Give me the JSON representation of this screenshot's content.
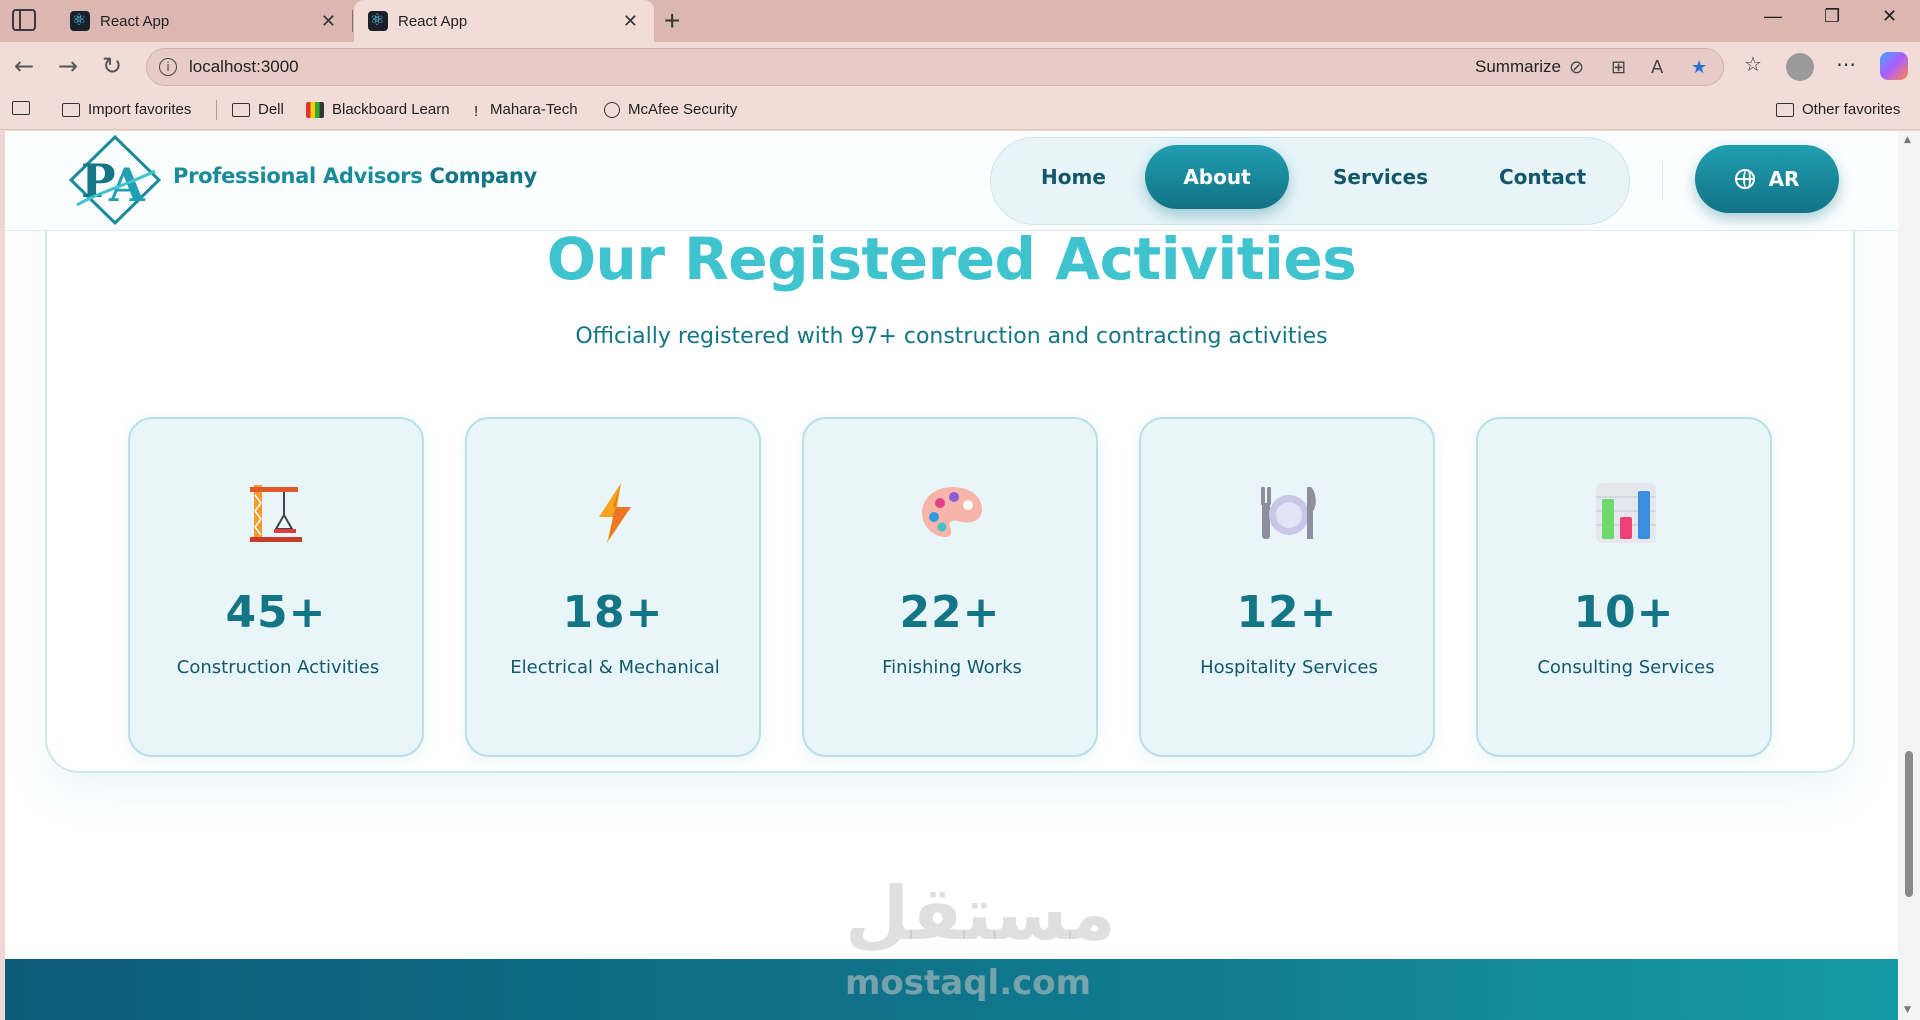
{
  "browser": {
    "tabs": [
      {
        "title": "React App",
        "active": false
      },
      {
        "title": "React App",
        "active": true
      }
    ],
    "url": "localhost:3000",
    "summarize_label": "Summarize",
    "bookmarks": [
      "Import favorites",
      "Dell",
      "Blackboard Learn",
      "Mahara-Tech",
      "McAfee Security"
    ],
    "other_favorites": "Other favorites"
  },
  "header": {
    "logo_text": "Professional Advisors",
    "logo_text_company": "Company",
    "nav": [
      {
        "label": "Home",
        "active": false
      },
      {
        "label": "About",
        "active": true
      },
      {
        "label": "Services",
        "active": false
      },
      {
        "label": "Contact",
        "active": false
      }
    ],
    "lang_label": "AR"
  },
  "section": {
    "title": "Our Registered Activities",
    "subtitle": "Officially registered with 97+ construction and contracting activities",
    "stats": [
      {
        "icon": "crane-icon",
        "value": "45+",
        "label": "Construction Activities"
      },
      {
        "icon": "lightning-icon",
        "value": "18+",
        "label": "Electrical & Mechanical"
      },
      {
        "icon": "palette-icon",
        "value": "22+",
        "label": "Finishing Works"
      },
      {
        "icon": "fork-knife-plate-icon",
        "value": "12+",
        "label": "Hospitality Services"
      },
      {
        "icon": "bar-chart-icon",
        "value": "10+",
        "label": "Consulting Services"
      }
    ]
  },
  "watermark": {
    "arabic": "مستقل",
    "latin": "mostaql.com"
  },
  "colors": {
    "accent": "#1f9fb0",
    "accent_dark": "#137585",
    "title_cyan": "#3fc3cf",
    "card_bg": "#e8f6fa"
  }
}
